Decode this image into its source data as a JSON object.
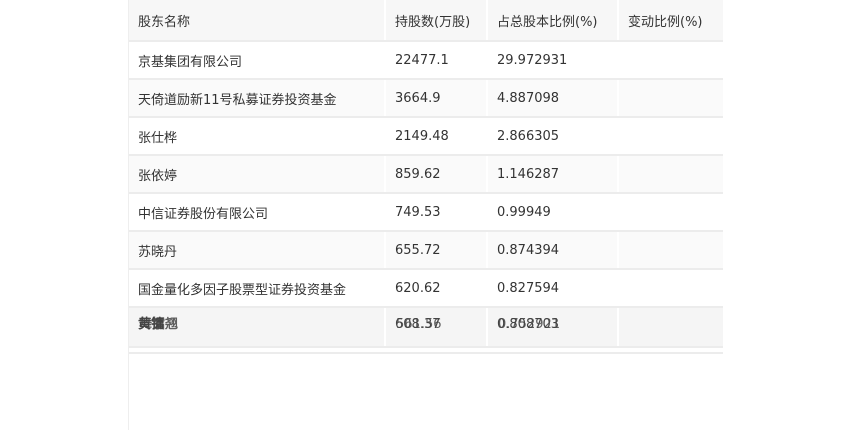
{
  "table": {
    "headers": [
      "股东名称",
      "持股数(万股)",
      "占总股本比例(%)",
      "变动比例(%)"
    ],
    "rows": [
      {
        "name": "京基集团有限公司",
        "shares": "22477.1",
        "ratio": "29.972931",
        "change": ""
      },
      {
        "name": "天倚道励新11号私募证券投资基金",
        "shares": "3664.9",
        "ratio": "4.887098",
        "change": ""
      },
      {
        "name": "张仕桦",
        "shares": "2149.48",
        "ratio": "2.866305",
        "change": ""
      },
      {
        "name": "张依婷",
        "shares": "859.62",
        "ratio": "1.146287",
        "change": ""
      },
      {
        "name": "中信证券股份有限公司",
        "shares": "749.53",
        "ratio": "0.99949",
        "change": ""
      },
      {
        "name": "苏晓丹",
        "shares": "655.72",
        "ratio": "0.874394",
        "change": ""
      },
      {
        "name": "国金量化多因子股票型证券投资基金",
        "shares": "620.62",
        "ratio": "0.827594",
        "change": ""
      }
    ],
    "overlap_row": {
      "name_a": "黄镛",
      "name_b": "舞擂翘",
      "shares_a": "608.37",
      "shares_b": "561.56",
      "ratio_a": "0.808703",
      "ratio_b": "0.752921",
      "change": ""
    }
  }
}
